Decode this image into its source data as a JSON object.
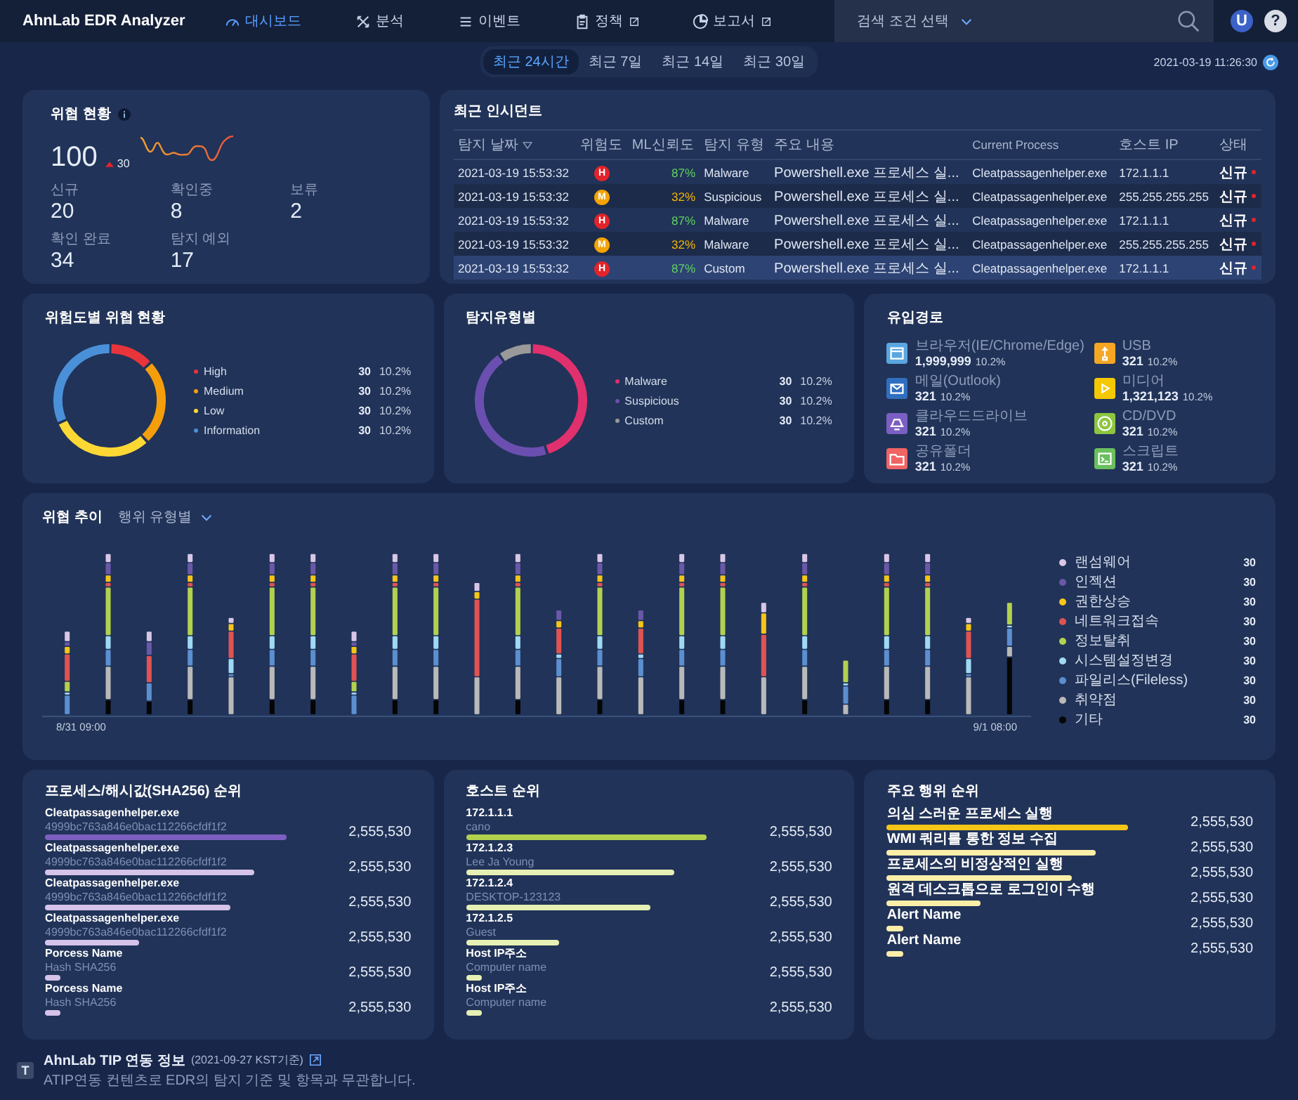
{
  "header": {
    "logo": "AhnLab EDR Analyzer",
    "nav": [
      {
        "label": "대시보드",
        "selected": true,
        "external": false
      },
      {
        "label": "분석",
        "selected": false,
        "external": false
      },
      {
        "label": "이벤트",
        "selected": false,
        "external": false
      },
      {
        "label": "정책",
        "selected": false,
        "external": true
      },
      {
        "label": "보고서",
        "selected": false,
        "external": true
      }
    ],
    "search": {
      "placeholder": "검색 조건 선택"
    },
    "avatar": "U",
    "help": "?"
  },
  "period": {
    "tabs": [
      {
        "label": "최근 24시간",
        "selected": true
      },
      {
        "label": "최근 7일",
        "selected": false
      },
      {
        "label": "최근 14일",
        "selected": false
      },
      {
        "label": "최근 30일",
        "selected": false
      }
    ],
    "updated": "2021-03-19 11:26:30"
  },
  "threat_status": {
    "title": "위협 현황",
    "total": "100",
    "change": "30",
    "stats": [
      {
        "label": "신규",
        "value": "20"
      },
      {
        "label": "확인중",
        "value": "8"
      },
      {
        "label": "보류",
        "value": "2"
      },
      {
        "label": "확인 완료",
        "value": "34"
      },
      {
        "label": "탐지 예외",
        "value": "17"
      }
    ]
  },
  "incidents": {
    "title": "최근 인시던트",
    "columns": [
      "탐지 날짜",
      "위험도",
      "ML신뢰도",
      "탐지 유형",
      "주요 내용",
      "Current Process",
      "호스트 IP",
      "상태"
    ],
    "rows": [
      {
        "date": "2021-03-19 15:53:32",
        "kind": "high",
        "badge": "H",
        "ml": "87%",
        "type": "Malware",
        "content": "Powershell.exe 프로세스 실...",
        "process": "Cleatpassagenhelper.exe",
        "ip": "172.1.1.1",
        "status": "신규",
        "selected": false
      },
      {
        "date": "2021-03-19 15:53:32",
        "kind": "medium",
        "badge": "M",
        "ml": "32%",
        "type": "Suspicious",
        "content": "Powershell.exe 프로세스 실...",
        "process": "Cleatpassagenhelper.exe",
        "ip": "255.255.255.255",
        "status": "신규",
        "selected": false
      },
      {
        "date": "2021-03-19 15:53:32",
        "kind": "high",
        "badge": "H",
        "ml": "87%",
        "type": "Malware",
        "content": "Powershell.exe 프로세스 실...",
        "process": "Cleatpassagenhelper.exe",
        "ip": "172.1.1.1",
        "status": "신규",
        "selected": false
      },
      {
        "date": "2021-03-19 15:53:32",
        "kind": "medium",
        "badge": "M",
        "ml": "32%",
        "type": "Malware",
        "content": "Powershell.exe 프로세스 실...",
        "process": "Cleatpassagenhelper.exe",
        "ip": "255.255.255.255",
        "status": "신규",
        "selected": false
      },
      {
        "date": "2021-03-19 15:53:32",
        "kind": "high",
        "badge": "H",
        "ml": "87%",
        "type": "Custom",
        "content": "Powershell.exe 프로세스 실...",
        "process": "Cleatpassagenhelper.exe",
        "ip": "172.1.1.1",
        "status": "신규",
        "selected": true
      }
    ]
  },
  "risk_levels": {
    "title": "위험도별 위협 현황",
    "items": [
      {
        "label": "High",
        "color": "#e8353b",
        "count": "30",
        "percent": "10.2%"
      },
      {
        "label": "Medium",
        "color": "#f59e0b",
        "count": "30",
        "percent": "10.2%"
      },
      {
        "label": "Low",
        "color": "#fdd835",
        "count": "30",
        "percent": "10.2%"
      },
      {
        "label": "Information",
        "color": "#4a90d9",
        "count": "30",
        "percent": "10.2%"
      }
    ]
  },
  "detection_types": {
    "title": "탐지유형별",
    "items": [
      {
        "label": "Malware",
        "color": "#e0306e",
        "count": "30",
        "percent": "10.2%"
      },
      {
        "label": "Suspicious",
        "color": "#6a4fb0",
        "count": "30",
        "percent": "10.2%"
      },
      {
        "label": "Custom",
        "color": "#9a9a9a",
        "count": "30",
        "percent": "10.2%"
      }
    ]
  },
  "inflow": {
    "title": "유입경로",
    "items": [
      {
        "label": "브라우저(IE/Chrome/Edge)",
        "count": "1,999,999",
        "percent": "10.2%",
        "color": "#5aa6e0"
      },
      {
        "label": "메일(Outlook)",
        "count": "321",
        "percent": "10.2%",
        "color": "#2f6fc0"
      },
      {
        "label": "클라우드드라이브",
        "count": "321",
        "percent": "10.2%",
        "color": "#7b5fc4"
      },
      {
        "label": "공유폴더",
        "count": "321",
        "percent": "10.2%",
        "color": "#f06464"
      },
      {
        "label": "USB",
        "count": "321",
        "percent": "10.2%",
        "color": "#f5a623"
      },
      {
        "label": "미디어",
        "count": "1,321,123",
        "percent": "10.2%",
        "color": "#f5c800"
      },
      {
        "label": "CD/DVD",
        "count": "321",
        "percent": "10.2%",
        "color": "#8cc63f"
      },
      {
        "label": "스크립트",
        "count": "321",
        "percent": "10.2%",
        "color": "#6abf5e"
      }
    ]
  },
  "trend": {
    "title": "위협 추이",
    "filter": "행위 유형별",
    "x_start": "8/31 09:00",
    "x_end": "9/1 08:00",
    "legend": [
      {
        "label": "랜섬웨어",
        "color": "#d9c6e6",
        "count": "30"
      },
      {
        "label": "인젝션",
        "color": "#6b58a8",
        "count": "30"
      },
      {
        "label": "권한상승",
        "color": "#f5c518",
        "count": "30"
      },
      {
        "label": "네트워크접속",
        "color": "#e05353",
        "count": "30"
      },
      {
        "label": "정보탈취",
        "color": "#b2d14f",
        "count": "30"
      },
      {
        "label": "시스템설정변경",
        "color": "#9fd8f5",
        "count": "30"
      },
      {
        "label": "파일리스(Fileless)",
        "color": "#5b8fd0",
        "count": "30"
      },
      {
        "label": "취약점",
        "color": "#b9b9b9",
        "count": "30"
      },
      {
        "label": "기타",
        "color": "#050505",
        "count": "30"
      }
    ]
  },
  "process_rank": {
    "title": "프로세스/해시값(SHA256) 순위",
    "items": [
      {
        "name": "Cleatpassagenhelper.exe",
        "detail": "4999bc763a846e0bac112266cfdf1f2",
        "value": "2,555,530"
      },
      {
        "name": "Cleatpassagenhelper.exe",
        "detail": "4999bc763a846e0bac112266cfdf1f2",
        "value": "2,555,530"
      },
      {
        "name": "Cleatpassagenhelper.exe",
        "detail": "4999bc763a846e0bac112266cfdf1f2",
        "value": "2,555,530"
      },
      {
        "name": "Cleatpassagenhelper.exe",
        "detail": "4999bc763a846e0bac112266cfdf1f2",
        "value": "2,555,530"
      },
      {
        "name": "Porcess Name",
        "detail": "Hash SHA256",
        "value": "2,555,530"
      },
      {
        "name": "Porcess Name",
        "detail": "Hash SHA256",
        "value": "2,555,530"
      }
    ]
  },
  "host_rank": {
    "title": "호스트 순위",
    "items": [
      {
        "name": "172.1.1.1",
        "detail": "cano",
        "value": "2,555,530"
      },
      {
        "name": "172.1.2.3",
        "detail": "Lee Ja Young",
        "value": "2,555,530"
      },
      {
        "name": "172.1.2.4",
        "detail": "DESKTOP-123123",
        "value": "2,555,530"
      },
      {
        "name": "172.1.2.5",
        "detail": "Guest",
        "value": "2,555,530"
      },
      {
        "name": "Host IP주소",
        "detail": "Computer name",
        "value": "2,555,530"
      },
      {
        "name": "Host IP주소",
        "detail": "Computer name",
        "value": "2,555,530"
      }
    ]
  },
  "behavior_rank": {
    "title": "주요 행위 순위",
    "items": [
      {
        "name": "의심 스러운 프로세스 실행",
        "value": "2,555,530"
      },
      {
        "name": "WMI 쿼리를 통한 정보 수집",
        "value": "2,555,530"
      },
      {
        "name": "프로세스의 비정상적인 실행",
        "value": "2,555,530"
      },
      {
        "name": "원격 데스크톱으로 로그인이 수행",
        "value": "2,555,530"
      },
      {
        "name": "Alert Name",
        "value": "2,555,530"
      },
      {
        "name": "Alert Name",
        "value": "2,555,530"
      }
    ]
  },
  "footer": {
    "badge": "T",
    "title": "AhnLab TIP 연동 정보",
    "date": "(2021-09-27 KST기준)",
    "note": "ATIP연동 컨텐츠로 EDR의 탐지 기준 및 항목과 무관합니다."
  }
}
